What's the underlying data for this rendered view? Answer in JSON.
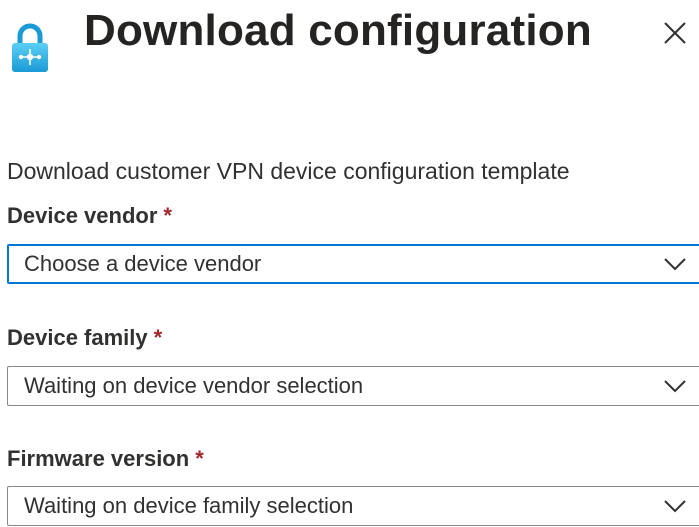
{
  "panel": {
    "title": "Download configuration",
    "icon": "vpn-lock-icon",
    "close_icon": "close-icon"
  },
  "form": {
    "description": "Download customer VPN device configuration template",
    "fields": [
      {
        "label": "Device vendor",
        "required_marker": "*",
        "value": "Choose a device vendor",
        "focused": true
      },
      {
        "label": "Device family",
        "required_marker": "*",
        "value": "Waiting on device vendor selection",
        "focused": false
      },
      {
        "label": "Firmware version",
        "required_marker": "*",
        "value": "Waiting on device family selection",
        "focused": false
      }
    ]
  },
  "colors": {
    "accent": "#0078d4",
    "required": "#a4262c",
    "text": "#323130",
    "border": "#8a8886",
    "icon_blue": "#1b9ad6",
    "icon_light": "#5ccff5"
  }
}
